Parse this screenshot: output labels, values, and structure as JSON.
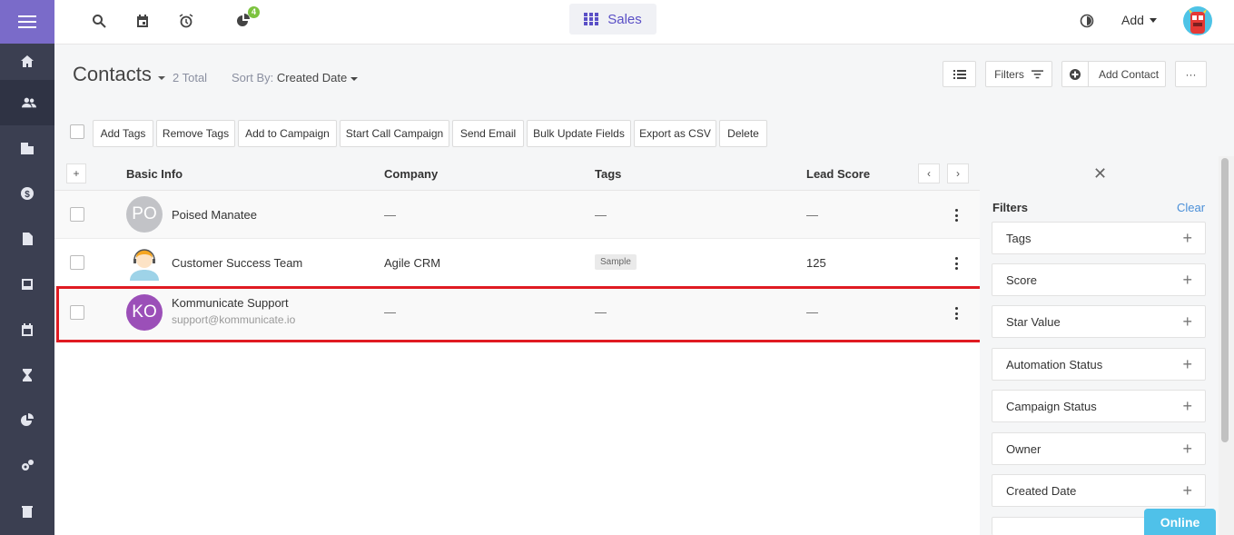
{
  "topbar": {
    "app_switcher_label": "Sales",
    "add_label": "Add",
    "notification_badge": "4",
    "icons": [
      "search-icon",
      "calendar-icon",
      "alarm-clock-icon",
      "reports-icon",
      "theme-toggle-icon"
    ]
  },
  "sidebar": {
    "items": [
      "home-icon",
      "contacts-icon",
      "companies-icon",
      "deals-icon",
      "documents-icon",
      "inbox-icon",
      "calendar-icon",
      "tasks-icon",
      "reports-icon",
      "settings-icon",
      "trash-icon"
    ]
  },
  "header": {
    "title": "Contacts",
    "total": "2 Total",
    "sort_prefix": "Sort By:",
    "sort_value": "Created Date",
    "filters_label": "Filters",
    "add_contact_label": "Add Contact",
    "more_label": "···"
  },
  "toolbar": {
    "buttons": [
      "Add Tags",
      "Remove Tags",
      "Add to Campaign",
      "Start Call Campaign",
      "Send Email",
      "Bulk Update Fields",
      "Export as CSV",
      "Delete"
    ]
  },
  "table": {
    "add_column_label": "+",
    "columns": [
      "Basic Info",
      "Company",
      "Tags",
      "Lead Score"
    ],
    "rows": [
      {
        "initials": "PO",
        "name": "Poised Manatee",
        "email": "",
        "company": "—",
        "tags": "—",
        "lead_score": "—",
        "avatar_color": "#c2c3c7"
      },
      {
        "initials": "",
        "name": "Customer Success Team",
        "email": "",
        "company": "Agile CRM",
        "tags": "Sample",
        "lead_score": "125",
        "avatar_color": "#ffffff"
      },
      {
        "initials": "KO",
        "name": "Kommunicate Support",
        "email": "support@kommunicate.io",
        "company": "—",
        "tags": "—",
        "lead_score": "—",
        "avatar_color": "#9b4fb8"
      }
    ]
  },
  "filters": {
    "title": "Filters",
    "clear_label": "Clear",
    "items": [
      "Tags",
      "Score",
      "Star Value",
      "Automation Status",
      "Campaign Status",
      "Owner",
      "Created Date"
    ]
  },
  "chat": {
    "status_label": "Online"
  },
  "colors": {
    "accent": "#5a4fc6",
    "sidebar_bg": "#3b3f51",
    "highlight": "#e01b22",
    "online": "#4fc1e9"
  }
}
